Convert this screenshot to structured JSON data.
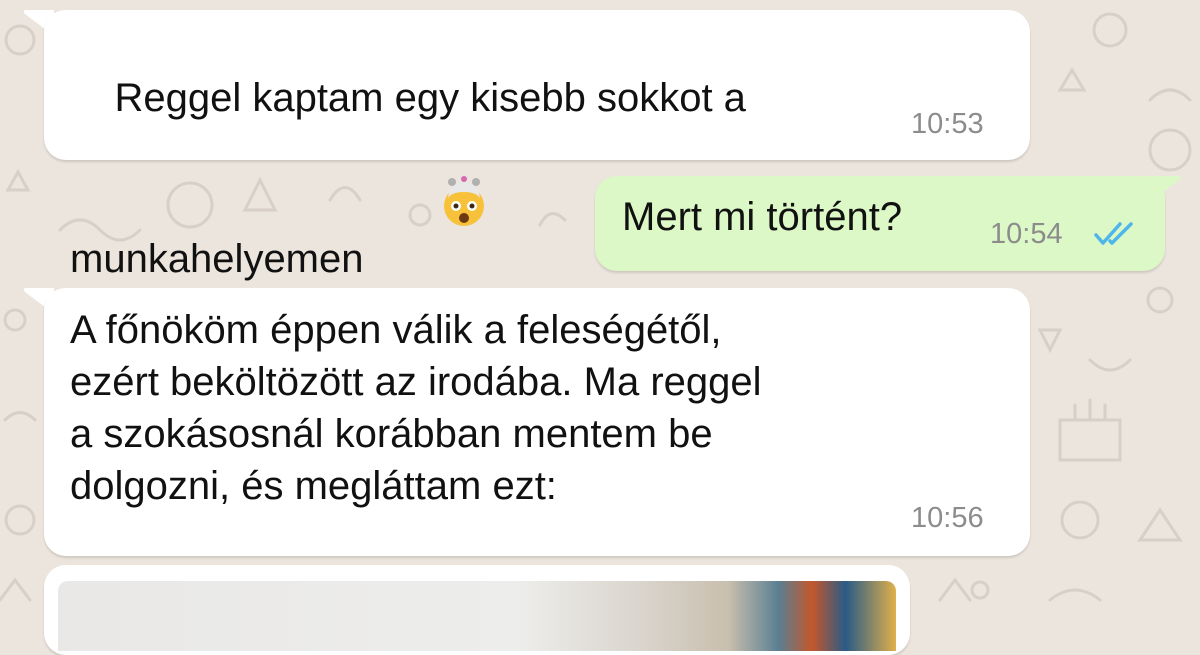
{
  "chat": {
    "theme": {
      "background": "#ece5dd",
      "incoming_bubble": "#ffffff",
      "outgoing_bubble": "#dcf8c6",
      "read_tick_color": "#4fb6ec"
    },
    "messages": [
      {
        "direction": "incoming",
        "text": "Reggel kaptam egy kisebb sokkot a\nmunkahelyemen",
        "emoji": "exploding-head-emoji",
        "time": "10:53"
      },
      {
        "direction": "outgoing",
        "text": "Mert mi történt?",
        "time": "10:54",
        "status": "read"
      },
      {
        "direction": "incoming",
        "text": "A főnököm éppen válik a feleségétől,\nezért beköltözött az irodába. Ma reggel\na szokásosnál korábban mentem be\ndolgozni, és megláttam ezt:",
        "time": "10:56"
      },
      {
        "direction": "incoming",
        "type": "image"
      }
    ]
  }
}
